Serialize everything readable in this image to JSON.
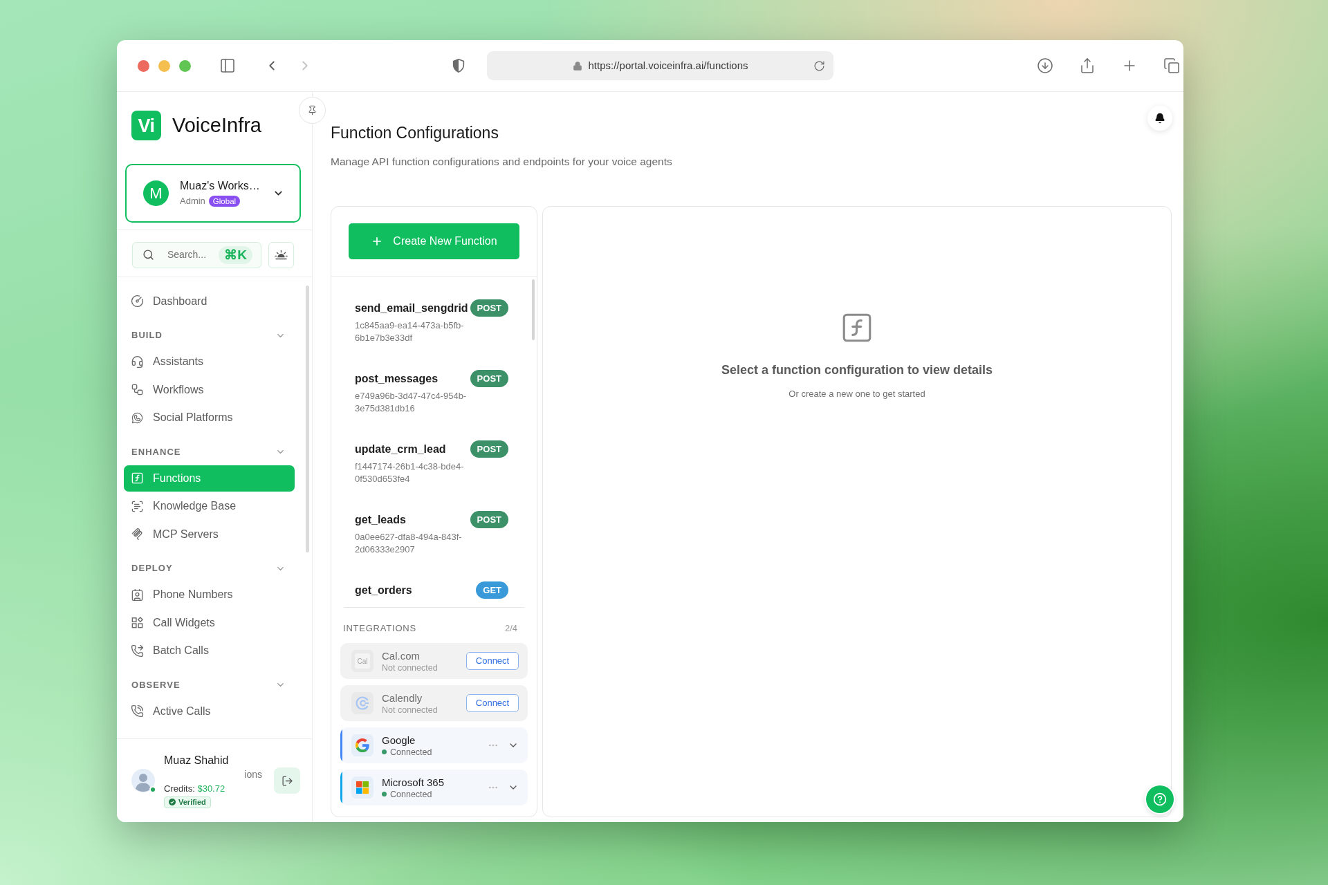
{
  "browser": {
    "url": "https://portal.voiceinfra.ai/functions",
    "back": {
      "disabled": false
    },
    "forward": {
      "disabled": true
    }
  },
  "sidebar": {
    "brand": {
      "logo": "Vi",
      "name": "VoiceInfra"
    },
    "workspace": {
      "avatar": "M",
      "name": "Muaz's Works…",
      "role": "Admin",
      "badge": "Global"
    },
    "search": {
      "placeholder": "Search...",
      "shortcut": "⌘K"
    },
    "nav": [
      {
        "kind": "link",
        "label": "Dashboard",
        "selected": false
      },
      {
        "kind": "section",
        "title": "BUILD",
        "expanded": true,
        "items": [
          {
            "label": "Assistants",
            "selected": false
          },
          {
            "label": "Workflows",
            "selected": false
          },
          {
            "label": "Social Platforms",
            "selected": false
          }
        ]
      },
      {
        "kind": "section",
        "title": "ENHANCE",
        "expanded": true,
        "items": [
          {
            "label": "Functions",
            "selected": true
          },
          {
            "label": "Knowledge Base",
            "selected": false
          },
          {
            "label": "MCP Servers",
            "selected": false
          }
        ]
      },
      {
        "kind": "section",
        "title": "DEPLOY",
        "expanded": true,
        "items": [
          {
            "label": "Phone Numbers",
            "selected": false
          },
          {
            "label": "Call Widgets",
            "selected": false
          },
          {
            "label": "Batch Calls",
            "selected": false
          }
        ]
      },
      {
        "kind": "section",
        "title": "OBSERVE",
        "expanded": true,
        "items": [
          {
            "label": "Active Calls",
            "selected": false
          }
        ]
      }
    ],
    "user": {
      "name": "Muaz Shahid",
      "fragment": "ions",
      "credits": {
        "label": "Credits:",
        "value": "$30.72"
      },
      "badge": "Verified",
      "online": true
    }
  },
  "header": {
    "title": "Function Configurations",
    "subtitle": "Manage API function configurations and endpoints for your voice agents"
  },
  "functions": {
    "create_button": "Create New Function",
    "items": [
      {
        "name": "send_email_sengdrid",
        "id": "1c845aa9-ea14-473a-b5fb-6b1e7b3e33df",
        "method": {
          "label": "POST",
          "color": "#3d9169"
        },
        "selected": false
      },
      {
        "name": "post_messages",
        "id": "e749a96b-3d47-47c4-954b-3e75d381db16",
        "method": {
          "label": "POST",
          "color": "#3d9169"
        },
        "selected": false
      },
      {
        "name": "update_crm_lead",
        "id": "f1447174-26b1-4c38-bde4-0f530d653fe4",
        "method": {
          "label": "POST",
          "color": "#3d9169"
        },
        "selected": false
      },
      {
        "name": "get_leads",
        "id": "0a0ee627-dfa8-494a-843f-2d06333e2907",
        "method": {
          "label": "POST",
          "color": "#3d9169"
        },
        "selected": false
      },
      {
        "name": "get_orders",
        "method": {
          "label": "GET",
          "color": "#3a9ad9"
        },
        "selected": false
      }
    ]
  },
  "integrations": {
    "title": "INTEGRATIONS",
    "count": "2/4",
    "items": [
      {
        "name": "Cal.com",
        "status": "Not connected",
        "connected": false,
        "action": "Connect",
        "logo_text": "Cal"
      },
      {
        "name": "Calendly",
        "status": "Not connected",
        "connected": false,
        "action": "Connect"
      },
      {
        "name": "Google",
        "status": "Connected",
        "connected": true,
        "color": "#4285f4"
      },
      {
        "name": "Microsoft 365",
        "status": "Connected",
        "connected": true,
        "color": "#0ea5e9"
      }
    ]
  },
  "details": {
    "title": "Select a function configuration to view details",
    "hint": "Or create a new one to get started"
  }
}
